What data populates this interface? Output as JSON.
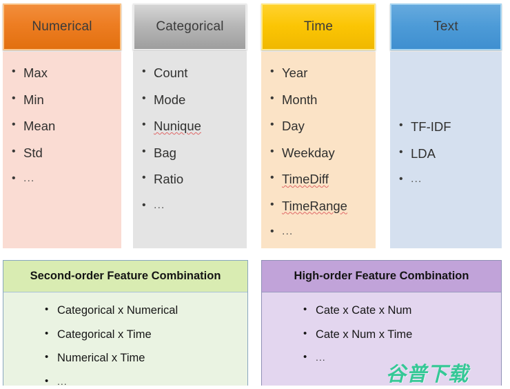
{
  "columns": [
    {
      "id": "numerical",
      "title": "Numerical",
      "header_color": "#ed7d22",
      "body_color": "#fadcd3",
      "items": [
        {
          "label": "Max",
          "misspelled": false
        },
        {
          "label": "Min",
          "misspelled": false
        },
        {
          "label": "Mean",
          "misspelled": false
        },
        {
          "label": "Std",
          "misspelled": false
        },
        {
          "label": "...",
          "misspelled": false,
          "ellipsis": true
        }
      ]
    },
    {
      "id": "categorical",
      "title": "Categorical",
      "header_color": "#b6b6b6",
      "body_color": "#e4e4e4",
      "items": [
        {
          "label": "Count",
          "misspelled": false
        },
        {
          "label": "Mode",
          "misspelled": false
        },
        {
          "label": "Nunique",
          "misspelled": true
        },
        {
          "label": "Bag",
          "misspelled": false
        },
        {
          "label": "Ratio",
          "misspelled": false
        },
        {
          "label": "...",
          "misspelled": false,
          "ellipsis": true
        }
      ]
    },
    {
      "id": "time",
      "title": "Time",
      "header_color": "#fbc504",
      "body_color": "#fbe3c6",
      "items": [
        {
          "label": "Year",
          "misspelled": false
        },
        {
          "label": "Month",
          "misspelled": false
        },
        {
          "label": "Day",
          "misspelled": false
        },
        {
          "label": "Weekday",
          "misspelled": false
        },
        {
          "label": "TimeDiff",
          "misspelled": true
        },
        {
          "label": "TimeRange",
          "misspelled": true
        },
        {
          "label": "...",
          "misspelled": false,
          "ellipsis": true
        }
      ]
    },
    {
      "id": "text",
      "title": "Text",
      "header_color": "#4d9bd7",
      "body_color": "#d5e0ef",
      "items": [
        {
          "label": "TF-IDF",
          "misspelled": false
        },
        {
          "label": "LDA",
          "misspelled": false
        },
        {
          "label": "...",
          "misspelled": false,
          "ellipsis": true
        }
      ]
    }
  ],
  "combos": [
    {
      "id": "second",
      "title": "Second-order Feature Combination",
      "header_color": "#d9ecb2",
      "body_color": "#eaf3e2",
      "items": [
        {
          "label": "Categorical x Numerical"
        },
        {
          "label": "Categorical x Time"
        },
        {
          "label": "Numerical x Time"
        },
        {
          "label": "...",
          "ellipsis": true
        }
      ]
    },
    {
      "id": "high",
      "title": "High-order Feature Combination",
      "header_color": "#c1a3d9",
      "body_color": "#e3d6ef",
      "items": [
        {
          "label": "Cate x Cate x Num"
        },
        {
          "label": "Cate x Num x Time"
        },
        {
          "label": "...",
          "ellipsis": true
        }
      ]
    }
  ],
  "watermark": {
    "text": "谷普下载",
    "color": "#35c896"
  }
}
